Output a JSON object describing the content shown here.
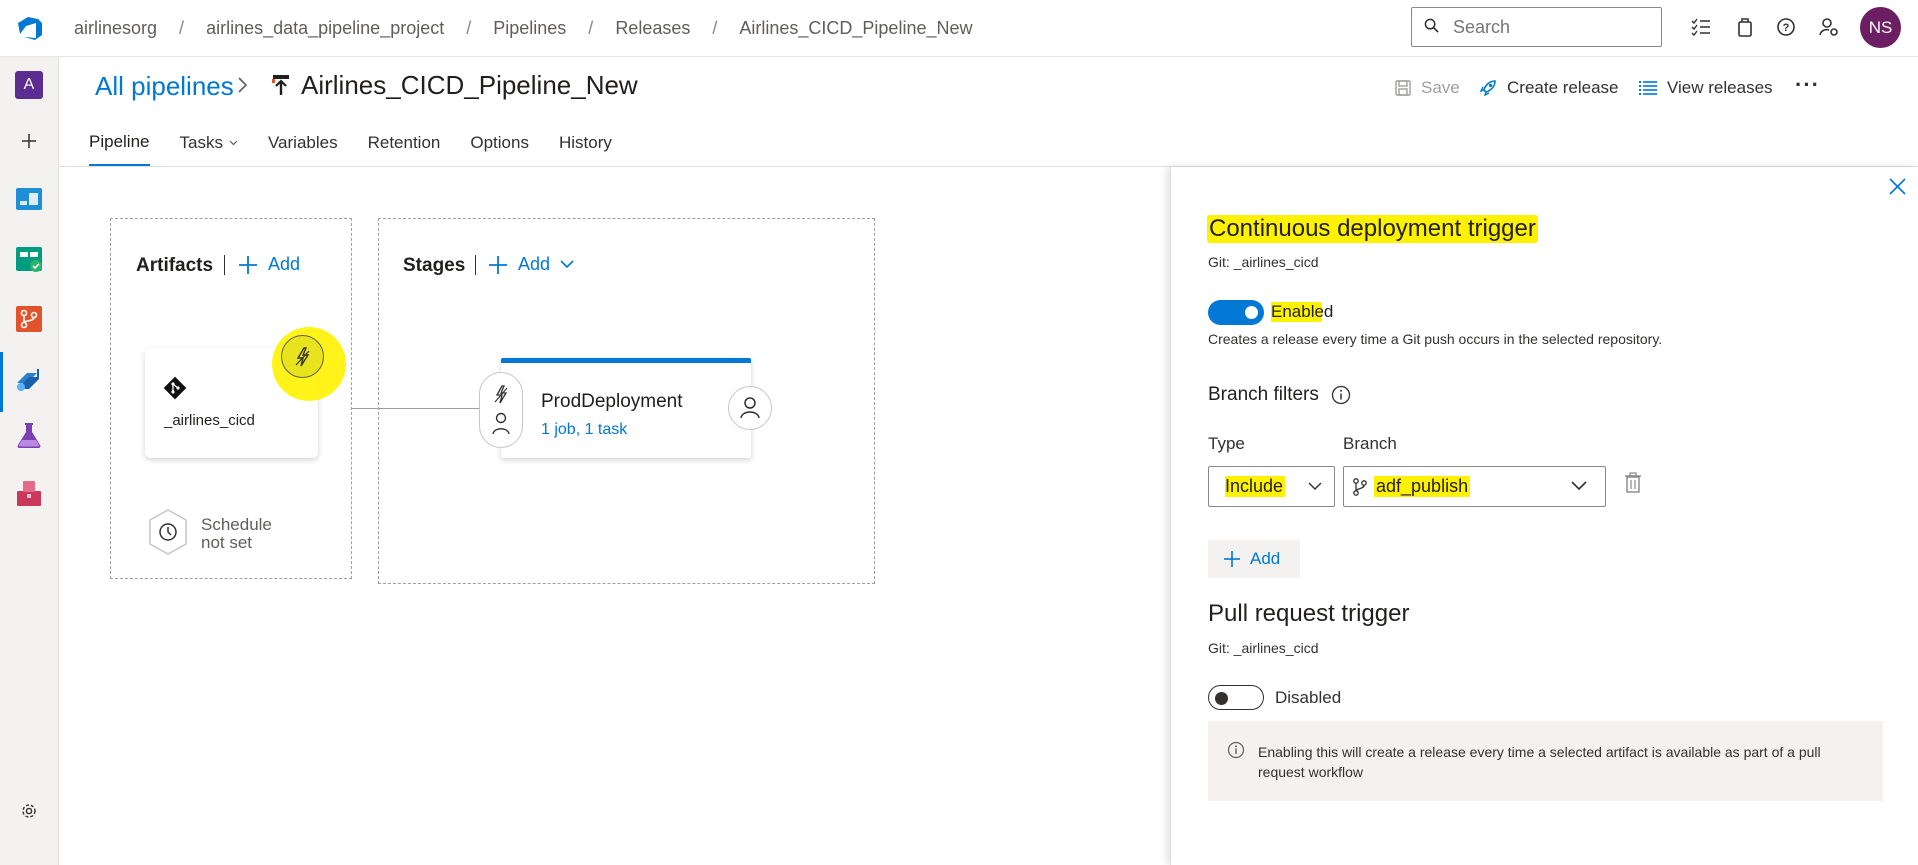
{
  "breadcrumb": [
    "airlinesorg",
    "airlines_data_pipeline_project",
    "Pipelines",
    "Releases",
    "Airlines_CICD_Pipeline_New"
  ],
  "search": {
    "placeholder": "Search"
  },
  "user": {
    "initials": "NS"
  },
  "rail": {
    "org_initial": "A"
  },
  "header": {
    "all_pipelines": "All pipelines",
    "title": "Airlines_CICD_Pipeline_New",
    "save": "Save",
    "create_release": "Create release",
    "view_releases": "View releases",
    "more": "···"
  },
  "tabs": [
    "Pipeline",
    "Tasks",
    "Variables",
    "Retention",
    "Options",
    "History"
  ],
  "artifacts": {
    "title": "Artifacts",
    "add": "Add",
    "artifact_name": "_airlines_cicd",
    "schedule_line1": "Schedule",
    "schedule_line2": "not set"
  },
  "stages": {
    "title": "Stages",
    "add": "Add",
    "stage_name": "ProdDeployment",
    "stage_summary": "1 job, 1 task"
  },
  "panel": {
    "cd_title": "Continuous deployment trigger",
    "cd_source": "Git: _airlines_cicd",
    "cd_toggle_label": "Enabled",
    "cd_description": "Creates a release every time a Git push occurs in the selected repository.",
    "branch_filters": "Branch filters",
    "type_label": "Type",
    "branch_label": "Branch",
    "type_value": "Include",
    "branch_value": "adf_publish",
    "add": "Add",
    "pr_title": "Pull request trigger",
    "pr_source": "Git: _airlines_cicd",
    "pr_toggle_label": "Disabled",
    "pr_info": "Enabling this will create a release every time a selected artifact is available as part of a pull request workflow"
  },
  "colors": {
    "accent": "#0078d4",
    "highlight": "#fff200",
    "org": "#5c2d91",
    "avatar": "#6b1e62"
  }
}
